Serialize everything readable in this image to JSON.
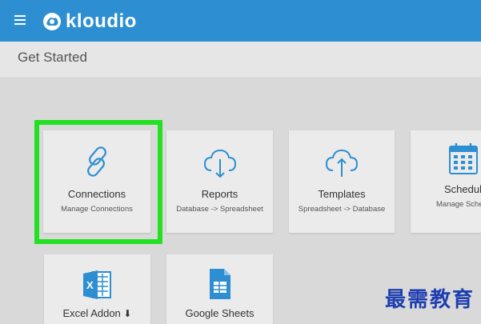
{
  "header": {
    "logo_text": "kloudio",
    "menu_icon": "hamburger-menu-icon",
    "brand_color": "#2d8fd1"
  },
  "subheader": {
    "title": "Get Started"
  },
  "cards": [
    {
      "title": "Connections",
      "subtitle": "Manage Connections",
      "icon": "link-icon",
      "highlighted": true
    },
    {
      "title": "Reports",
      "subtitle": "Database -> Spreadsheet",
      "icon": "cloud-download-icon"
    },
    {
      "title": "Templates",
      "subtitle": "Spreadsheet -> Database",
      "icon": "cloud-upload-icon"
    },
    {
      "title": "Schedules",
      "subtitle": "Manage Schedu",
      "icon": "calendar-icon"
    },
    {
      "title": "Excel Addon",
      "subtitle": "",
      "icon": "excel-icon"
    },
    {
      "title": "Google Sheets",
      "subtitle": "",
      "icon": "google-sheets-icon"
    }
  ],
  "highlight_color": "#22e022",
  "icon_color": "#2d8fd1",
  "watermark": "最需教育"
}
